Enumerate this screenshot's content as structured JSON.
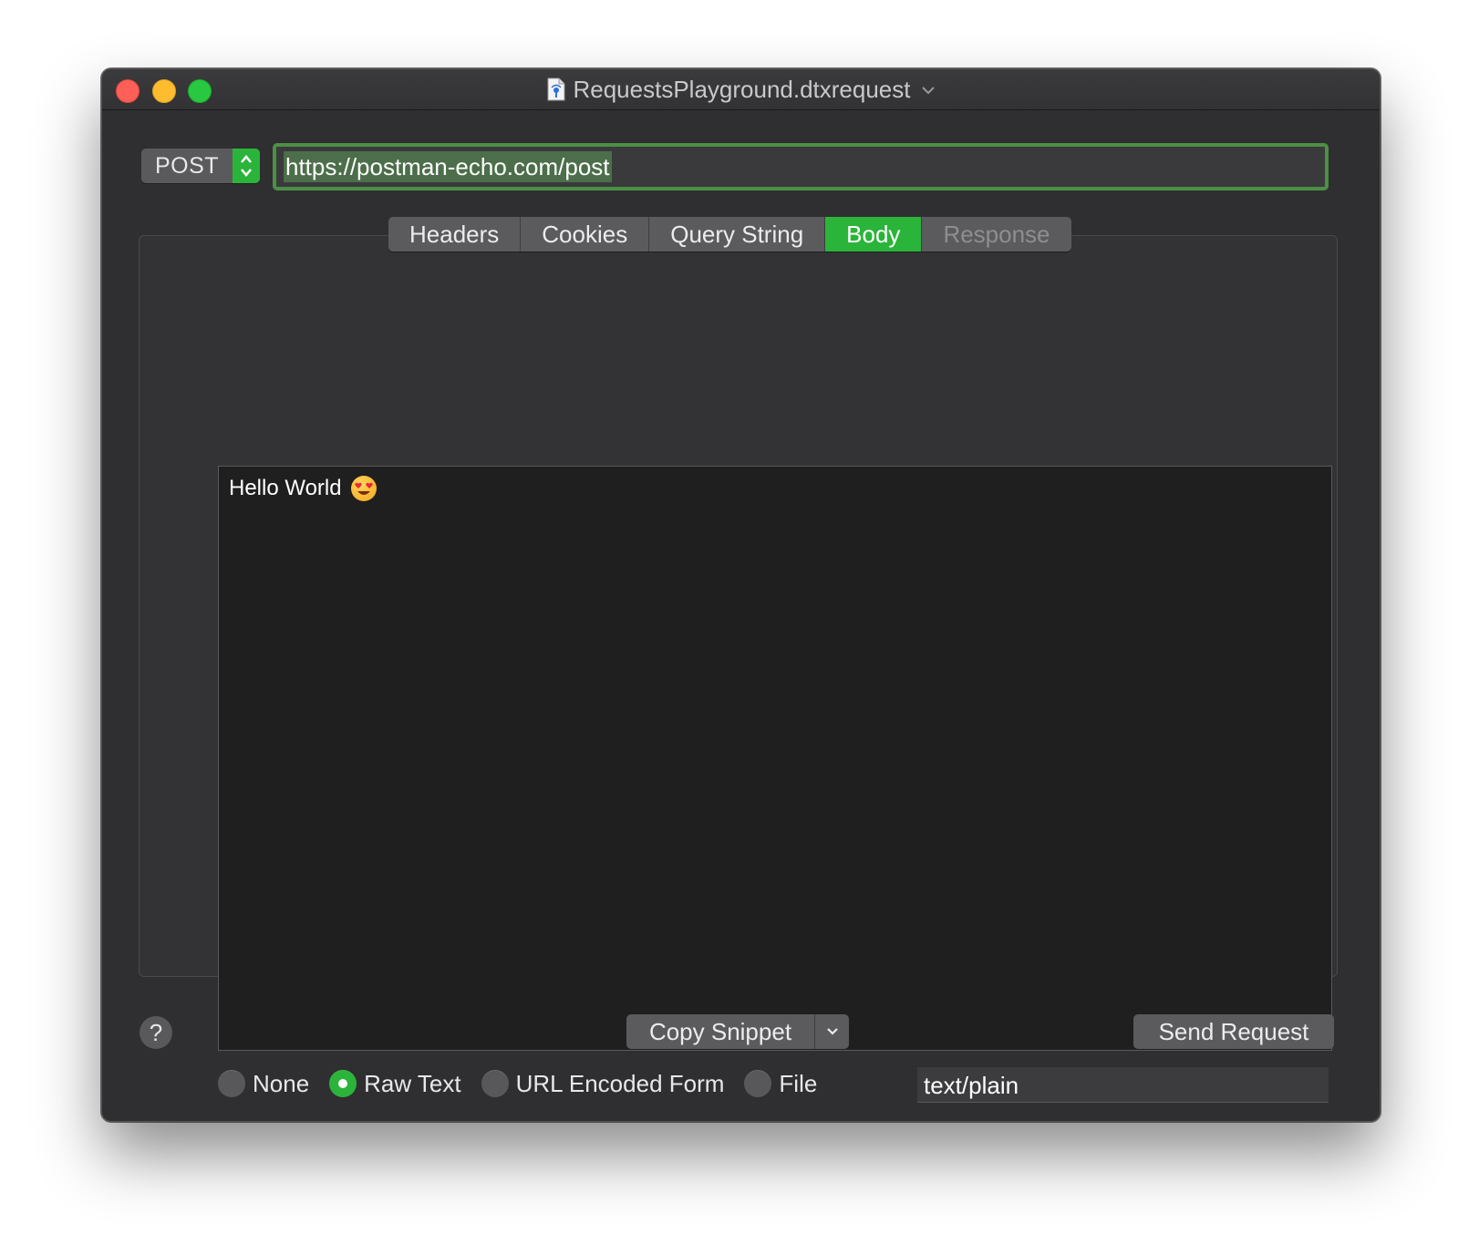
{
  "window": {
    "title": "RequestsPlayground.dtxrequest"
  },
  "request": {
    "method": "POST",
    "url": "https://postman-echo.com/post"
  },
  "tabs": [
    {
      "label": "Headers",
      "state": "normal"
    },
    {
      "label": "Cookies",
      "state": "normal"
    },
    {
      "label": "Query String",
      "state": "normal"
    },
    {
      "label": "Body",
      "state": "selected"
    },
    {
      "label": "Response",
      "state": "disabled"
    }
  ],
  "body": {
    "text": "Hello World",
    "emoji": "smiling-face-with-heart-eyes",
    "types": [
      {
        "label": "None",
        "selected": false
      },
      {
        "label": "Raw Text",
        "selected": true
      },
      {
        "label": "URL Encoded Form",
        "selected": false
      },
      {
        "label": "File",
        "selected": false
      }
    ],
    "content_type": "text/plain"
  },
  "footer": {
    "help_label": "?",
    "copy_snippet_label": "Copy Snippet",
    "send_label": "Send Request"
  },
  "colors": {
    "accent": "#2bb43a",
    "window_bg": "#2f2f31",
    "editor_bg": "#1f1f1f"
  }
}
